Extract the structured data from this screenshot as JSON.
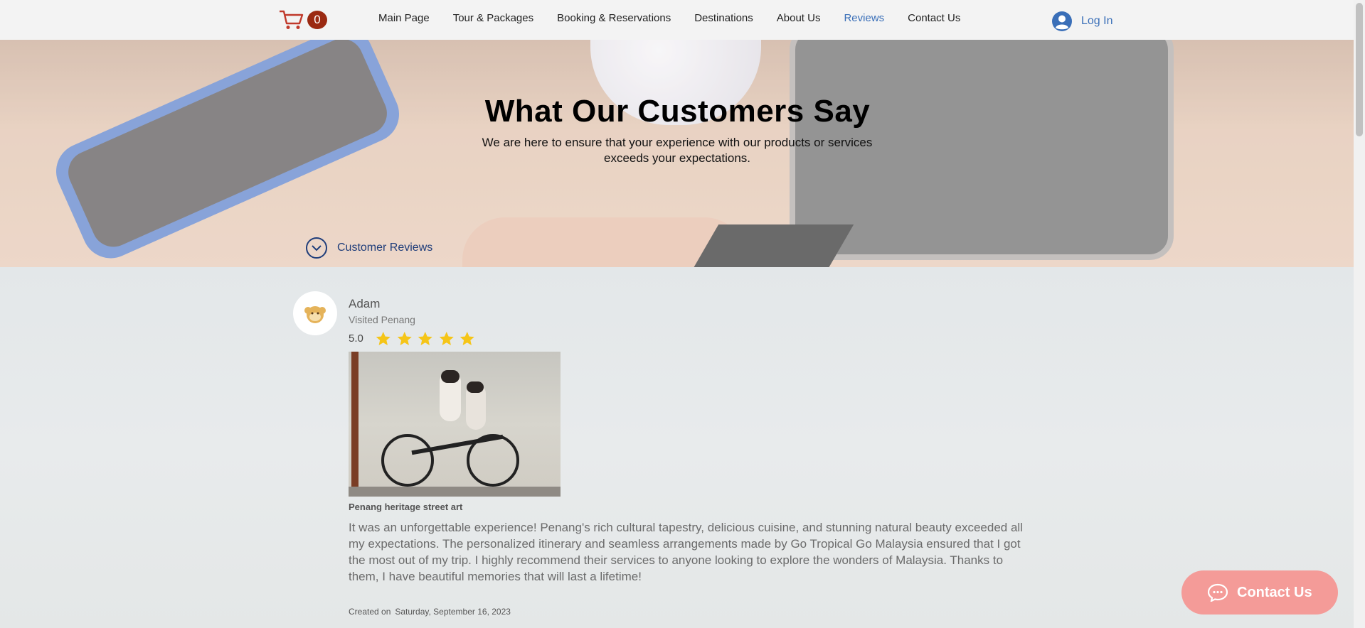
{
  "header": {
    "cart_count": "0",
    "nav": [
      {
        "label": "Main Page"
      },
      {
        "label": "Tour & Packages"
      },
      {
        "label": "Booking & Reservations"
      },
      {
        "label": "Destinations"
      },
      {
        "label": "About Us"
      },
      {
        "label": "Reviews",
        "active": true
      },
      {
        "label": "Contact Us"
      }
    ],
    "login_label": "Log In"
  },
  "hero": {
    "title": "What Our Customers Say",
    "subtitle": "We are here to ensure that your experience with our products or services exceeds your expectations.",
    "anchor_label": "Customer Reviews"
  },
  "review": {
    "name": "Adam",
    "visited": "Visited Penang",
    "score": "5.0",
    "rating": 5,
    "image_caption": "Penang heritage street art",
    "text": "It was an unforgettable experience! Penang's rich cultural tapestry, delicious cuisine, and stunning natural beauty exceeded all my expectations. The personalized itinerary and seamless arrangements made by Go Tropical Go Malaysia ensured that I got the most out of my trip. I highly recommend their services to anyone looking to explore the wonders of Malaysia. Thanks to them, I have beautiful memories that will last a lifetime!",
    "created_label": "Created on",
    "created_date": "Saturday, September 16, 2023"
  },
  "fab": {
    "label": "Contact Us"
  },
  "colors": {
    "accent": "#3a6fb8",
    "cart_badge": "#9b2a12",
    "star": "#f5c518",
    "fab": "#f49b98",
    "anchor": "#1f3d7a"
  }
}
